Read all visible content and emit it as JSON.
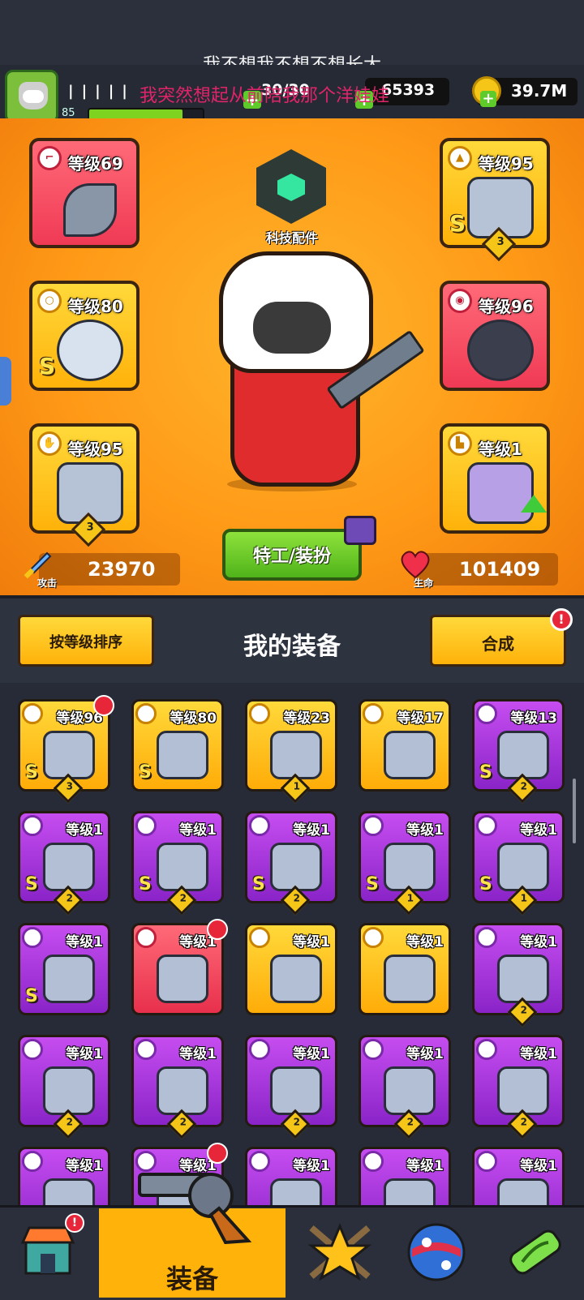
{
  "overlay": {
    "lyric_top": "我不想我不想不想长大",
    "lyric_bottom": "我突然想起从前陪我那个洋娃娃"
  },
  "player": {
    "level": "85",
    "xp_fraction": 0.82,
    "energy": "30/30",
    "gems": "65393",
    "coins": "39.7M"
  },
  "tech_label": "科技配件",
  "hero_slots": [
    {
      "name": "weapon",
      "level": "等级69",
      "color": "red",
      "rank": "",
      "count": ""
    },
    {
      "name": "armor",
      "level": "等级95",
      "color": "yellow",
      "rank": "S",
      "count": "3"
    },
    {
      "name": "ring",
      "level": "等级80",
      "color": "yellow",
      "rank": "S",
      "count": ""
    },
    {
      "name": "belt",
      "level": "等级96",
      "color": "red",
      "rank": "",
      "count": ""
    },
    {
      "name": "glove",
      "level": "等级95",
      "color": "yellow",
      "rank": "",
      "count": "3"
    },
    {
      "name": "boots",
      "level": "等级1",
      "color": "yellow",
      "rank": "",
      "count": ""
    }
  ],
  "agent_button": "特工/装扮",
  "stats": {
    "attack_label": "攻击",
    "attack_value": "23970",
    "hp_label": "生命",
    "hp_value": "101409"
  },
  "equipment": {
    "sort_button": "按等级排序",
    "title": "我的装备",
    "merge_button": "合成",
    "merge_alert": "!"
  },
  "grid_items": [
    {
      "level": "等级96",
      "color": "yellow",
      "rank": "S",
      "count": "3",
      "new": true
    },
    {
      "level": "等级80",
      "color": "yellow",
      "rank": "S",
      "count": "",
      "new": false
    },
    {
      "level": "等级23",
      "color": "yellow",
      "rank": "",
      "count": "1",
      "new": false
    },
    {
      "level": "等级17",
      "color": "yellow",
      "rank": "",
      "count": "",
      "new": false
    },
    {
      "level": "等级13",
      "color": "purple",
      "rank": "S",
      "count": "2",
      "new": false
    },
    {
      "level": "等级1",
      "color": "purple",
      "rank": "S",
      "count": "2",
      "new": false
    },
    {
      "level": "等级1",
      "color": "purple",
      "rank": "S",
      "count": "2",
      "new": false
    },
    {
      "level": "等级1",
      "color": "purple",
      "rank": "S",
      "count": "2",
      "new": false
    },
    {
      "level": "等级1",
      "color": "purple",
      "rank": "S",
      "count": "1",
      "new": false
    },
    {
      "level": "等级1",
      "color": "purple",
      "rank": "S",
      "count": "1",
      "new": false
    },
    {
      "level": "等级1",
      "color": "purple",
      "rank": "S",
      "count": "",
      "new": false
    },
    {
      "level": "等级1",
      "color": "red",
      "rank": "",
      "count": "",
      "new": true
    },
    {
      "level": "等级1",
      "color": "yellow",
      "rank": "",
      "count": "",
      "new": false
    },
    {
      "level": "等级1",
      "color": "yellow",
      "rank": "",
      "count": "",
      "new": false
    },
    {
      "level": "等级1",
      "color": "purple",
      "rank": "",
      "count": "2",
      "new": false
    },
    {
      "level": "等级1",
      "color": "purple",
      "rank": "",
      "count": "2",
      "new": false
    },
    {
      "level": "等级1",
      "color": "purple",
      "rank": "",
      "count": "2",
      "new": false
    },
    {
      "level": "等级1",
      "color": "purple",
      "rank": "",
      "count": "2",
      "new": false
    },
    {
      "level": "等级1",
      "color": "purple",
      "rank": "",
      "count": "2",
      "new": false
    },
    {
      "level": "等级1",
      "color": "purple",
      "rank": "",
      "count": "2",
      "new": false
    },
    {
      "level": "等级1",
      "color": "purple",
      "rank": "",
      "count": "",
      "new": false
    },
    {
      "level": "等级1",
      "color": "purple",
      "rank": "",
      "count": "",
      "new": true
    },
    {
      "level": "等级1",
      "color": "purple",
      "rank": "",
      "count": "",
      "new": false
    },
    {
      "level": "等级1",
      "color": "purple",
      "rank": "",
      "count": "",
      "new": false
    },
    {
      "level": "等级1",
      "color": "purple",
      "rank": "",
      "count": "",
      "new": false
    }
  ],
  "bottom_nav": {
    "shop_alert": "!",
    "selected_label": "装备",
    "tabs": [
      "shop-icon",
      "revolver-icon",
      "star-swords-icon",
      "orb-icon",
      "dna-capsule-icon"
    ]
  },
  "colors": {
    "hero_orange": "#ff9a17",
    "slot_red": "#f03a55",
    "slot_yellow": "#ffb20a",
    "slot_purple": "#8a24c8",
    "button_green": "#5ecb2a"
  }
}
